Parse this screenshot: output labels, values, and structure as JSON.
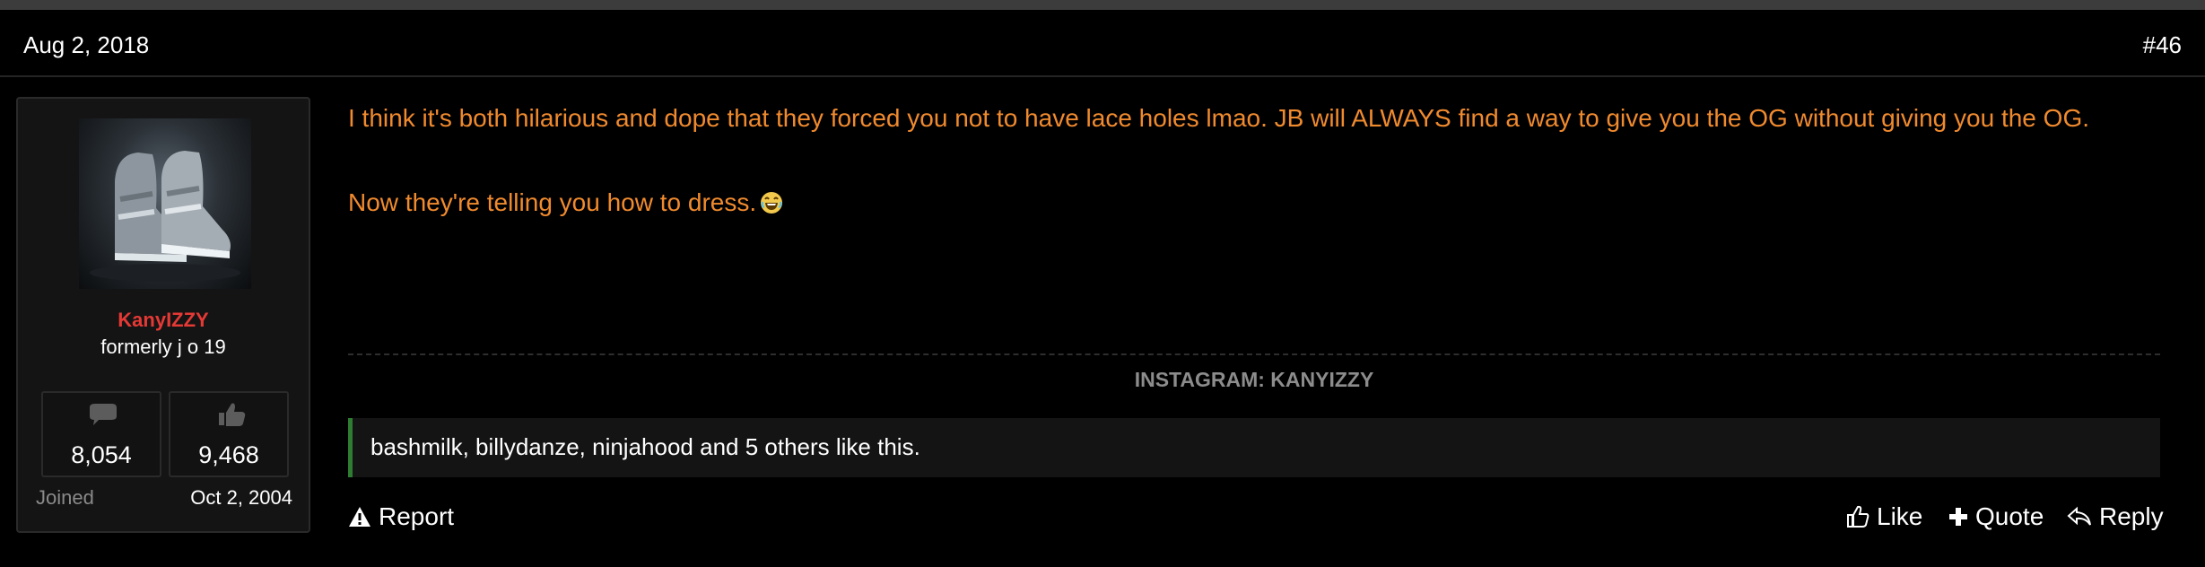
{
  "post": {
    "date": "Aug 2, 2018",
    "number": "#46"
  },
  "user": {
    "username": "KanyIZZY",
    "title": "formerly j o 19",
    "messages": "8,054",
    "reactions": "9,468",
    "joined_label": "Joined",
    "joined_date": "Oct 2, 2004"
  },
  "message": {
    "line1": "I think it's both hilarious and dope that they forced you not to have lace holes lmao. JB will ALWAYS find a way to give you the OG without giving you the OG.",
    "line2": "Now they're telling you how to dress.",
    "emoji": "laughing-emoji"
  },
  "signature": "INSTAGRAM: KANYIZZY",
  "likes": "bashmilk, billydanze, ninjahood and 5 others like this.",
  "actions": {
    "report": "Report",
    "like": "Like",
    "quote": "Quote",
    "reply": "Reply"
  },
  "colors": {
    "message_text": "#f08a2e",
    "username": "#e53935",
    "likes_accent": "#2e7d32"
  }
}
